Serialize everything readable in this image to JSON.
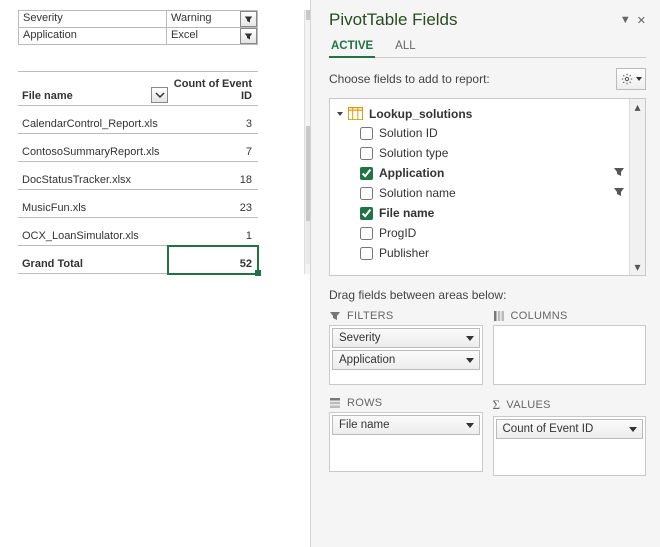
{
  "filters_left": [
    {
      "label": "Severity",
      "value": "Warning"
    },
    {
      "label": "Application",
      "value": "Excel"
    }
  ],
  "pivot_headers": {
    "row": "File name",
    "val": "Count of Event ID"
  },
  "pivot_rows": [
    {
      "name": "CalendarControl_Report.xls",
      "count": 3
    },
    {
      "name": "ContosoSummaryReport.xls",
      "count": 7
    },
    {
      "name": "DocStatusTracker.xlsx",
      "count": 18
    },
    {
      "name": "MusicFun.xls",
      "count": 23
    },
    {
      "name": "OCX_LoanSimulator.xls",
      "count": 1
    }
  ],
  "grand_total_label": "Grand Total",
  "grand_total_value": 52,
  "pane": {
    "title": "PivotTable Fields",
    "tabs": {
      "active": "ACTIVE",
      "all": "ALL"
    },
    "instruction": "Choose fields to add to report:",
    "table_name": "Lookup_solutions",
    "fields": [
      {
        "name": "Solution ID",
        "checked": false,
        "filtered": false
      },
      {
        "name": "Solution type",
        "checked": false,
        "filtered": false
      },
      {
        "name": "Application",
        "checked": true,
        "filtered": true
      },
      {
        "name": "Solution name",
        "checked": false,
        "filtered": true
      },
      {
        "name": "File name",
        "checked": true,
        "filtered": false
      },
      {
        "name": "ProgID",
        "checked": false,
        "filtered": false
      },
      {
        "name": "Publisher",
        "checked": false,
        "filtered": false
      }
    ],
    "drag_label": "Drag fields between areas below:",
    "area_labels": {
      "filters": "FILTERS",
      "columns": "COLUMNS",
      "rows": "ROWS",
      "values": "VALUES"
    },
    "areas": {
      "filters": [
        "Severity",
        "Application"
      ],
      "columns": [],
      "rows": [
        "File name"
      ],
      "values": [
        "Count of Event ID"
      ]
    }
  }
}
